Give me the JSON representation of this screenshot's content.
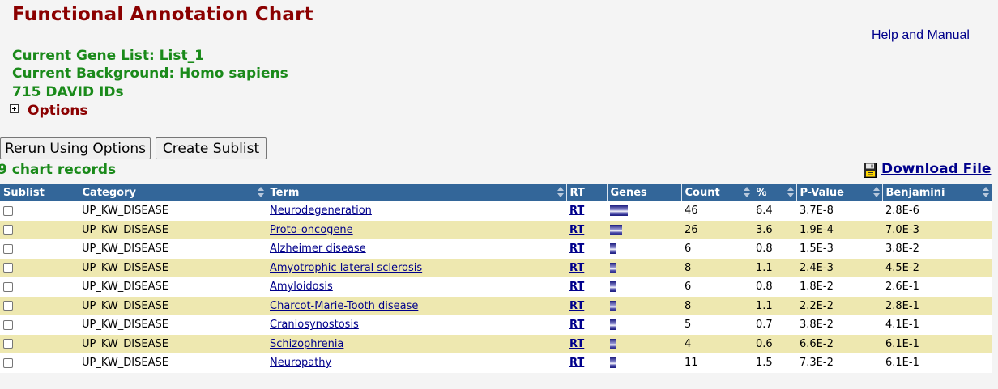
{
  "header": {
    "title": "Functional Annotation Chart",
    "help_link": "Help and Manual",
    "gene_list": "Current Gene List: List_1",
    "background": "Current Background: Homo sapiens",
    "ids": "715 DAVID IDs",
    "options_label": "Options"
  },
  "toolbar": {
    "rerun_label": "Rerun Using Options",
    "sublist_label": "Create Sublist",
    "records": "9 chart records",
    "download_label": "Download File"
  },
  "table": {
    "columns": [
      "Sublist",
      "Category",
      "Term",
      "RT",
      "Genes",
      "Count",
      "%",
      "P-Value",
      "Benjamini"
    ],
    "rows": [
      {
        "category": "UP_KW_DISEASE",
        "term": "Neurodegeneration",
        "rt": "RT",
        "count": "46",
        "percent": "6.4",
        "pvalue": "3.7E-8",
        "benjamini": "2.8E-6"
      },
      {
        "category": "UP_KW_DISEASE",
        "term": "Proto-oncogene",
        "rt": "RT",
        "count": "26",
        "percent": "3.6",
        "pvalue": "1.9E-4",
        "benjamini": "7.0E-3"
      },
      {
        "category": "UP_KW_DISEASE",
        "term": "Alzheimer disease",
        "rt": "RT",
        "count": "6",
        "percent": "0.8",
        "pvalue": "1.5E-3",
        "benjamini": "3.8E-2"
      },
      {
        "category": "UP_KW_DISEASE",
        "term": "Amyotrophic lateral sclerosis",
        "rt": "RT",
        "count": "8",
        "percent": "1.1",
        "pvalue": "2.4E-3",
        "benjamini": "4.5E-2"
      },
      {
        "category": "UP_KW_DISEASE",
        "term": "Amyloidosis",
        "rt": "RT",
        "count": "6",
        "percent": "0.8",
        "pvalue": "1.8E-2",
        "benjamini": "2.6E-1"
      },
      {
        "category": "UP_KW_DISEASE",
        "term": "Charcot-Marie-Tooth disease",
        "rt": "RT",
        "count": "8",
        "percent": "1.1",
        "pvalue": "2.2E-2",
        "benjamini": "2.8E-1"
      },
      {
        "category": "UP_KW_DISEASE",
        "term": "Craniosynostosis",
        "rt": "RT",
        "count": "5",
        "percent": "0.7",
        "pvalue": "3.8E-2",
        "benjamini": "4.1E-1"
      },
      {
        "category": "UP_KW_DISEASE",
        "term": "Schizophrenia",
        "rt": "RT",
        "count": "4",
        "percent": "0.6",
        "pvalue": "6.6E-2",
        "benjamini": "6.1E-1"
      },
      {
        "category": "UP_KW_DISEASE",
        "term": "Neuropathy",
        "rt": "RT",
        "count": "11",
        "percent": "1.5",
        "pvalue": "7.3E-2",
        "benjamini": "6.1E-1"
      }
    ]
  },
  "colors": {
    "title": "#8b0000",
    "info": "#1a8a1a",
    "header_bg": "#336699",
    "row_alt": "#eee8b0",
    "link": "#00008b"
  },
  "icons": {
    "options": "plus-box-icon",
    "download": "floppy-disk-icon",
    "sort": "sort-arrows-icon"
  }
}
